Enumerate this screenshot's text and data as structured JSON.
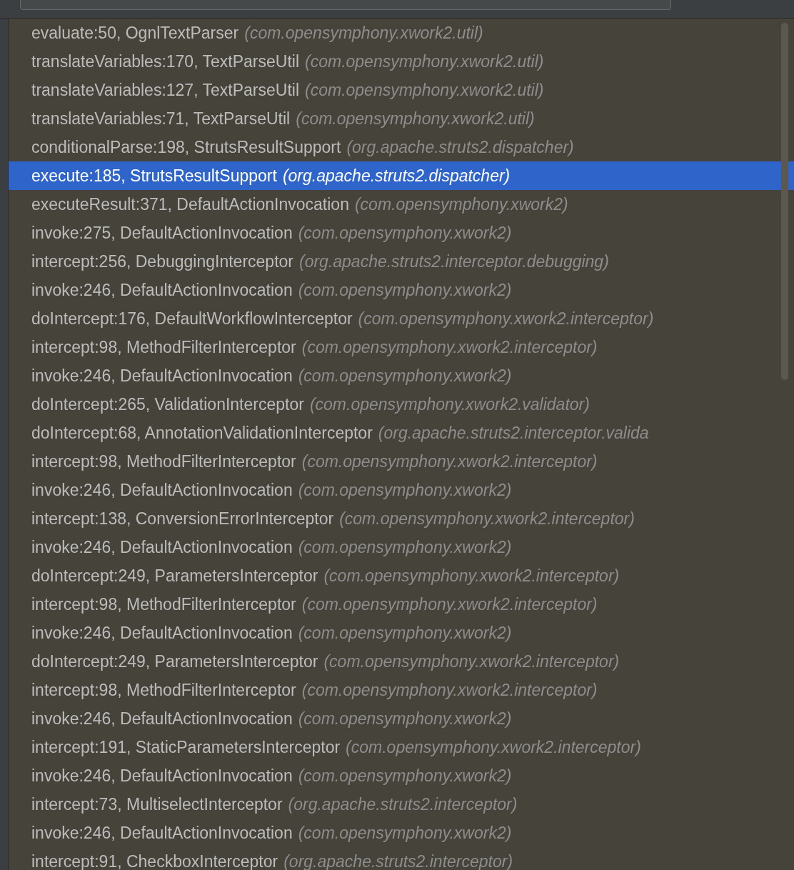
{
  "frames": [
    {
      "method": "evaluate:50, OgnlTextParser",
      "package": "(com.opensymphony.xwork2.util)",
      "selected": false
    },
    {
      "method": "translateVariables:170, TextParseUtil",
      "package": "(com.opensymphony.xwork2.util)",
      "selected": false
    },
    {
      "method": "translateVariables:127, TextParseUtil",
      "package": "(com.opensymphony.xwork2.util)",
      "selected": false
    },
    {
      "method": "translateVariables:71, TextParseUtil",
      "package": "(com.opensymphony.xwork2.util)",
      "selected": false
    },
    {
      "method": "conditionalParse:198, StrutsResultSupport",
      "package": "(org.apache.struts2.dispatcher)",
      "selected": false
    },
    {
      "method": "execute:185, StrutsResultSupport",
      "package": "(org.apache.struts2.dispatcher)",
      "selected": true
    },
    {
      "method": "executeResult:371, DefaultActionInvocation",
      "package": "(com.opensymphony.xwork2)",
      "selected": false
    },
    {
      "method": "invoke:275, DefaultActionInvocation",
      "package": "(com.opensymphony.xwork2)",
      "selected": false
    },
    {
      "method": "intercept:256, DebuggingInterceptor",
      "package": "(org.apache.struts2.interceptor.debugging)",
      "selected": false
    },
    {
      "method": "invoke:246, DefaultActionInvocation",
      "package": "(com.opensymphony.xwork2)",
      "selected": false
    },
    {
      "method": "doIntercept:176, DefaultWorkflowInterceptor",
      "package": "(com.opensymphony.xwork2.interceptor)",
      "selected": false
    },
    {
      "method": "intercept:98, MethodFilterInterceptor",
      "package": "(com.opensymphony.xwork2.interceptor)",
      "selected": false
    },
    {
      "method": "invoke:246, DefaultActionInvocation",
      "package": "(com.opensymphony.xwork2)",
      "selected": false
    },
    {
      "method": "doIntercept:265, ValidationInterceptor",
      "package": "(com.opensymphony.xwork2.validator)",
      "selected": false
    },
    {
      "method": "doIntercept:68, AnnotationValidationInterceptor",
      "package": "(org.apache.struts2.interceptor.valida",
      "selected": false
    },
    {
      "method": "intercept:98, MethodFilterInterceptor",
      "package": "(com.opensymphony.xwork2.interceptor)",
      "selected": false
    },
    {
      "method": "invoke:246, DefaultActionInvocation",
      "package": "(com.opensymphony.xwork2)",
      "selected": false
    },
    {
      "method": "intercept:138, ConversionErrorInterceptor",
      "package": "(com.opensymphony.xwork2.interceptor)",
      "selected": false
    },
    {
      "method": "invoke:246, DefaultActionInvocation",
      "package": "(com.opensymphony.xwork2)",
      "selected": false
    },
    {
      "method": "doIntercept:249, ParametersInterceptor",
      "package": "(com.opensymphony.xwork2.interceptor)",
      "selected": false
    },
    {
      "method": "intercept:98, MethodFilterInterceptor",
      "package": "(com.opensymphony.xwork2.interceptor)",
      "selected": false
    },
    {
      "method": "invoke:246, DefaultActionInvocation",
      "package": "(com.opensymphony.xwork2)",
      "selected": false
    },
    {
      "method": "doIntercept:249, ParametersInterceptor",
      "package": "(com.opensymphony.xwork2.interceptor)",
      "selected": false
    },
    {
      "method": "intercept:98, MethodFilterInterceptor",
      "package": "(com.opensymphony.xwork2.interceptor)",
      "selected": false
    },
    {
      "method": "invoke:246, DefaultActionInvocation",
      "package": "(com.opensymphony.xwork2)",
      "selected": false
    },
    {
      "method": "intercept:191, StaticParametersInterceptor",
      "package": "(com.opensymphony.xwork2.interceptor)",
      "selected": false
    },
    {
      "method": "invoke:246, DefaultActionInvocation",
      "package": "(com.opensymphony.xwork2)",
      "selected": false
    },
    {
      "method": "intercept:73, MultiselectInterceptor",
      "package": "(org.apache.struts2.interceptor)",
      "selected": false
    },
    {
      "method": "invoke:246, DefaultActionInvocation",
      "package": "(com.opensymphony.xwork2)",
      "selected": false
    },
    {
      "method": "intercept:91, CheckboxInterceptor",
      "package": "(org.apache.struts2.interceptor)",
      "selected": false
    }
  ]
}
